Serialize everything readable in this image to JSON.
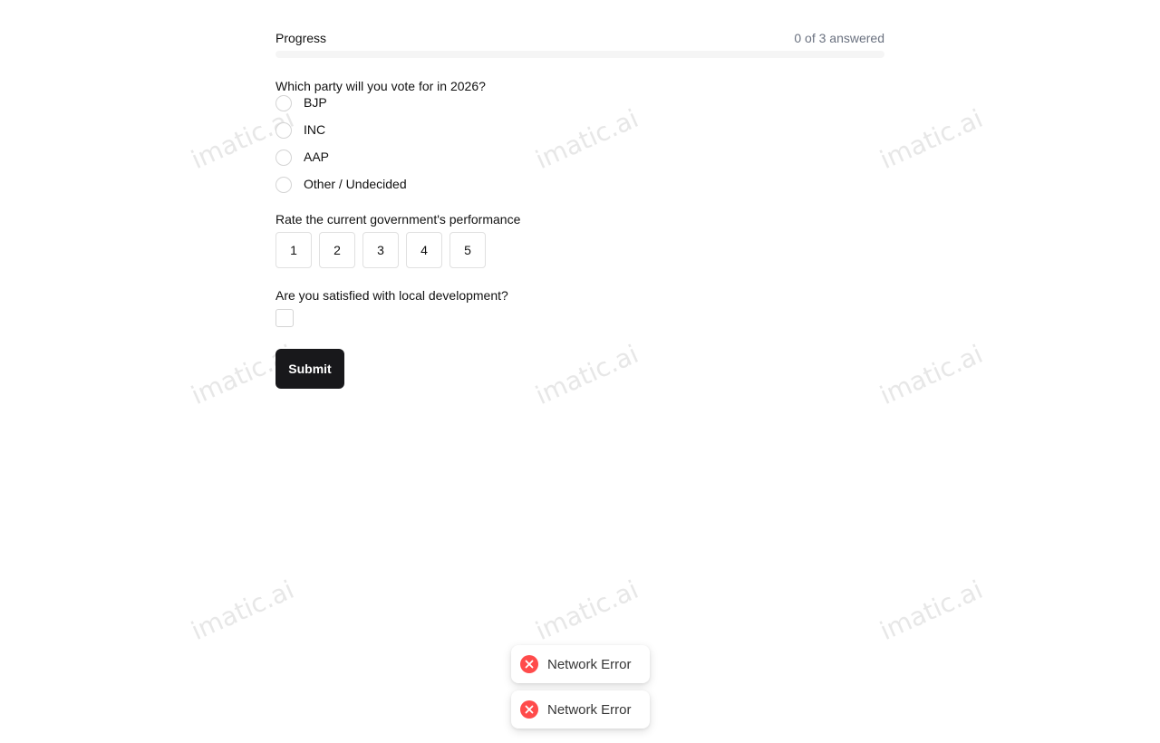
{
  "progress": {
    "label": "Progress",
    "count_text": "0 of 3 answered",
    "fraction": 0
  },
  "questions": {
    "party": {
      "text": "Which party will you vote for in 2026?",
      "options": [
        "BJP",
        "INC",
        "AAP",
        "Other / Undecided"
      ]
    },
    "rating": {
      "text": "Rate the current government's performance",
      "values": [
        "1",
        "2",
        "3",
        "4",
        "5"
      ]
    },
    "satisfied": {
      "text": "Are you satisfied with local development?",
      "checked": false
    }
  },
  "submit_label": "Submit",
  "toasts": [
    {
      "message": "Network Error",
      "type": "error",
      "icon": "error-x-icon"
    },
    {
      "message": "Network Error",
      "type": "error",
      "icon": "error-x-icon"
    }
  ],
  "watermark_text": "imatic.ai",
  "colors": {
    "primary": "#18181b",
    "error": "#ff4b4b",
    "muted_text": "#6b7280"
  }
}
